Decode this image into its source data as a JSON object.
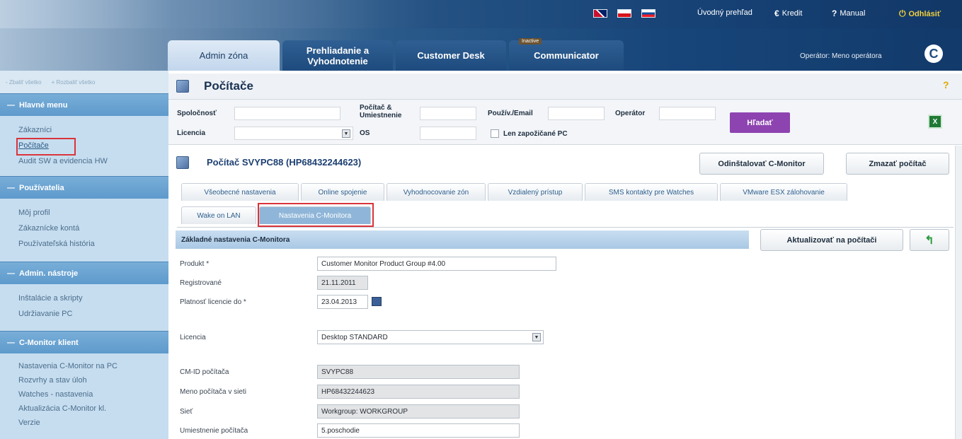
{
  "header": {
    "top_links": {
      "overview": "Úvodný prehľad",
      "credit": "Kredit",
      "manual": "Manual",
      "logout": "Odhlásiť"
    },
    "icons": {
      "credit": "euro-icon",
      "manual": "question-icon",
      "logout": "power-icon"
    },
    "languages": [
      "uk-flag-icon",
      "cz-flag-icon",
      "sk-flag-icon"
    ],
    "tabs": [
      {
        "label": "Admin zóna",
        "active": true
      },
      {
        "label": "Prehliadanie a Vyhodnotenie",
        "active": false
      },
      {
        "label": "Customer Desk",
        "active": false
      },
      {
        "label": "Communicator",
        "active": false
      }
    ],
    "communicator_badge": "Inactive",
    "operator": "Operátor: Meno operátora",
    "logo": "C"
  },
  "sidebar": {
    "collapse_all": "Zbaliť všetko",
    "expand_all": "Rozbaliť všetko",
    "sections": [
      {
        "title": "Hlavné menu",
        "items": [
          "Zákazníci",
          "Počítače",
          "Audit SW a evidencia HW"
        ]
      },
      {
        "title": "Používatelia",
        "items": [
          "Môj profil",
          "Zákaznícke kontá",
          "Používateľská história"
        ]
      },
      {
        "title": "Admin. nástroje",
        "items": [
          "Inštalácie a skripty",
          "Udržiavanie PC"
        ]
      },
      {
        "title": "C-Monitor klient",
        "items": [
          "Nastavenia C-Monitor na PC",
          "Rozvrhy a stav úloh",
          "Watches - nastavenia",
          "Aktualizácia C-Monitor kl.",
          "Verzie"
        ]
      }
    ],
    "selected_item": "Počítače"
  },
  "page": {
    "title": "Počítače",
    "help": "?"
  },
  "filter": {
    "company_label": "Spoločnosť",
    "computer_label": "Počítač & Umiestnenie",
    "user_label": "Použív./Email",
    "operator_label": "Operátor",
    "license_label": "Licencia",
    "os_label": "OS",
    "loaned_label": "Len zapožičané PC",
    "search_button": "Hľadať",
    "excel_icon": "excel-icon"
  },
  "computer": {
    "title": "Počítač SVYPC88 (HP68432244623)",
    "uninstall_button": "Odinštalovať C-Monitor",
    "delete_button": "Zmazať počítač",
    "tabs_row1": [
      "Všeobecné nastavenia",
      "Online spojenie",
      "Vyhodnocovanie zón",
      "Vzdialený prístup",
      "SMS kontakty pre Watches",
      "VMware ESX zálohovanie"
    ],
    "tabs_row2": [
      "Wake on LAN",
      "Nastavenia C-Monitora"
    ],
    "active_tab": "Nastavenia C-Monitora",
    "section_title": "Základné nastavenia C-Monitora",
    "update_button": "Aktualizovať na počítači",
    "back_icon": "back-arrow-icon"
  },
  "form": {
    "product_label": "Produkt *",
    "product_value": "Customer Monitor Product Group #4.00",
    "registered_label": "Registrované",
    "registered_value": "21.11.2011",
    "license_valid_label": "Platnosť licencie do *",
    "license_valid_value": "23.04.2013",
    "license_label": "Licencia",
    "license_value": "Desktop STANDARD",
    "cmid_label": "CM-ID počítača",
    "cmid_value": "SVYPC88",
    "netname_label": "Meno počítača v sieti",
    "netname_value": "HP68432244623",
    "network_label": "Sieť",
    "network_value": "Workgroup: WORKGROUP",
    "location_label": "Umiestnenie počítača",
    "location_value": "5.poschodie"
  }
}
